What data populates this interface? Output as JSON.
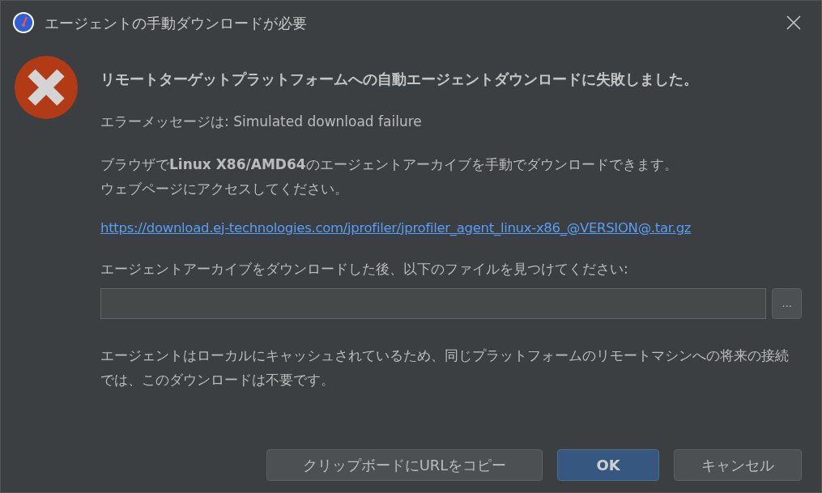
{
  "window": {
    "title": "エージェントの手動ダウンロードが必要"
  },
  "heading": "リモートターゲットプラットフォームへの自動エージェントダウンロードに失敗しました。",
  "error_message": "エラーメッセージは: Simulated download failure",
  "instructions": [
    "ブラウザで**Linux X86/AMD64**のエージェントアーカイブを手動でダウンロードできます。",
    "ウェブページにアクセスしてください。"
  ],
  "link": "https://download.ej-technologies.com/jprofiler/jprofiler_agent_linux-x86_@VERSION@.tar.gz",
  "file_label": "エージェントアーカイブをダウンロードした後、以下のファイルを見つけてください:",
  "browse_button": "...",
  "note": "エージェントはローカルにキャッシュされているため、同じプラットフォームのリモートマシンへの将来の接続では、このダウンロードは不要です。",
  "buttons": [
    {
      "label": "クリップボードにURLをコピー",
      "kind": "default"
    },
    {
      "label": "OK",
      "kind": "primary"
    },
    {
      "label": "キャンセル",
      "kind": "default"
    }
  ]
}
